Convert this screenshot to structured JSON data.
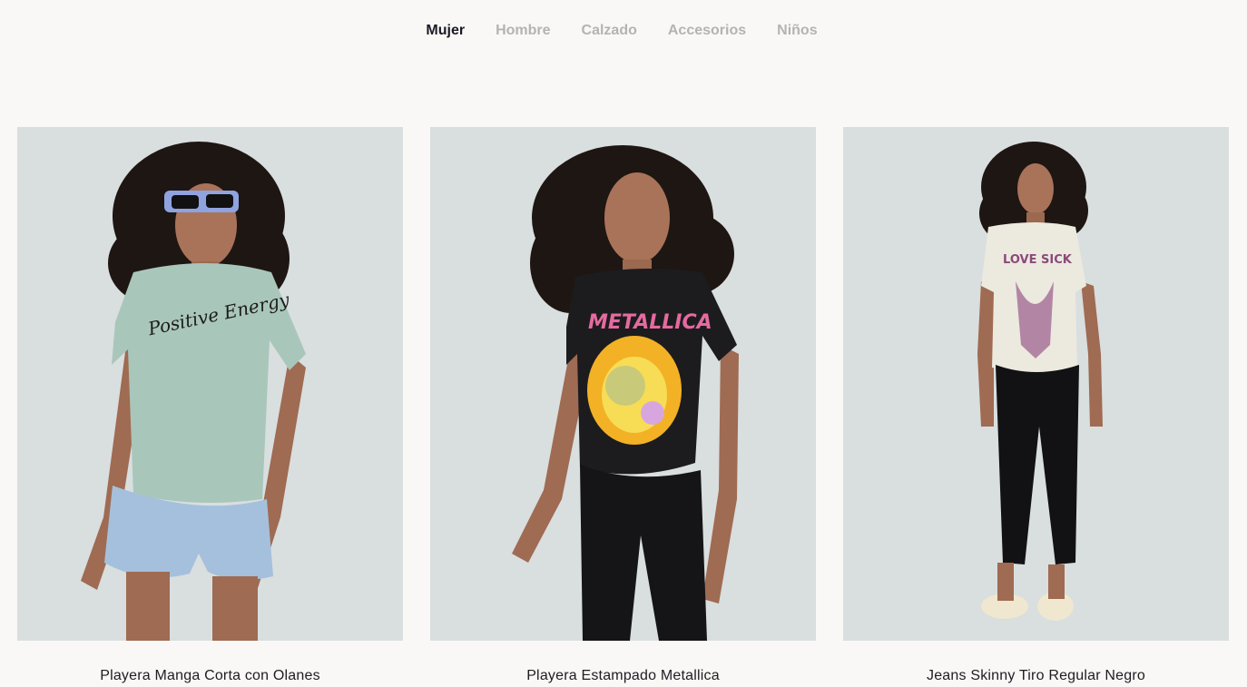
{
  "nav": {
    "tabs": [
      {
        "label": "Mujer",
        "active": true
      },
      {
        "label": "Hombre",
        "active": false
      },
      {
        "label": "Calzado",
        "active": false
      },
      {
        "label": "Accesorios",
        "active": false
      },
      {
        "label": "Niños",
        "active": false
      }
    ]
  },
  "products": [
    {
      "name": "Playera Manga Corta con Olanes",
      "tee_print": "Positive Energy",
      "tee_color": "#a9c6bb",
      "bottom_color": "#a5c0dc"
    },
    {
      "name": "Playera Estampado Metallica",
      "tee_print": "METALLICA",
      "tee_color": "#1c1c1e",
      "bottom_color": "#151517"
    },
    {
      "name": "Jeans Skinny Tiro Regular Negro",
      "tee_print": "LOVE SICK",
      "tee_color": "#ece9df",
      "bottom_color": "#121214"
    }
  ],
  "colors": {
    "background": "#f9f8f6",
    "photo_bg": "#d9dedf",
    "tab_active": "#1b1a26",
    "tab_inactive": "#b5b3b2"
  }
}
